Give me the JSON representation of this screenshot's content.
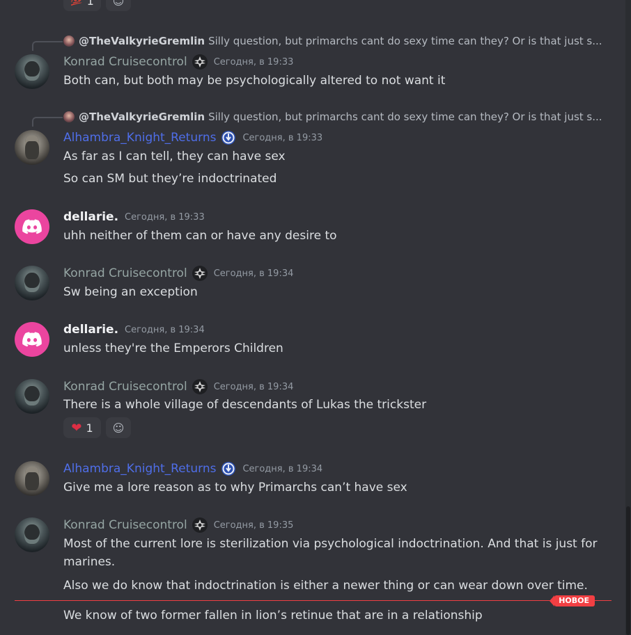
{
  "top_reactions": [
    {
      "emoji": "💯",
      "count": "1"
    },
    {
      "emoji": "☺"
    }
  ],
  "messages": [
    {
      "reply": {
        "name": "@TheValkyrieGremlin",
        "text": "Silly question, but primarchs cant do sexy time can they? Or is that just s..."
      },
      "author": "Konrad Cruisecontrol",
      "timestamp": "Сегодня, в 19:33",
      "lines": [
        "Both can, but both may be psychologically altered to not want it"
      ]
    },
    {
      "reply": {
        "name": "@TheValkyrieGremlin",
        "text": "Silly question, but primarchs cant do sexy time can they? Or is that just s..."
      },
      "author": "Alhambra_Knight_Returns",
      "timestamp": "Сегодня, в 19:33",
      "lines": [
        "As far as I can tell, they can have sex",
        "So can SM but they’re indoctrinated"
      ]
    },
    {
      "author": "dellarie.",
      "timestamp": "Сегодня, в 19:33",
      "lines": [
        "uhh neither of them can or have any desire to"
      ]
    },
    {
      "author": "Konrad Cruisecontrol",
      "timestamp": "Сегодня, в 19:34",
      "lines": [
        "Sw being an exception"
      ]
    },
    {
      "author": "dellarie.",
      "timestamp": "Сегодня, в 19:34",
      "lines": [
        "unless they're the Emperors Children"
      ]
    },
    {
      "author": "Konrad Cruisecontrol",
      "timestamp": "Сегодня, в 19:34",
      "lines": [
        "There is a whole village of descendants of Lukas the trickster"
      ],
      "reactions": [
        {
          "emoji": "❤",
          "count": "1"
        },
        {
          "emoji": "☺"
        }
      ]
    },
    {
      "author": "Alhambra_Knight_Returns",
      "timestamp": "Сегодня, в 19:34",
      "lines": [
        "Give me a lore reason as to why Primarchs can’t have sex"
      ]
    },
    {
      "author": "Konrad Cruisecontrol",
      "timestamp": "Сегодня, в 19:35",
      "lines": [
        "Most of the current lore is sterilization via psychological indoctrination. And that is just for marines.",
        "Also we do know that indoctrination is either a newer thing or can wear down over time.",
        "We know of two former fallen in lion’s retinue that are in a relationship"
      ]
    }
  ],
  "new_divider_label": "НОВОЕ",
  "colors": {
    "background": "#323339",
    "konrad_name": "#95a5a3",
    "alhambra_name": "#4f6ee8",
    "new_divider": "#f23f43",
    "discord_avatar": "#eb459f"
  },
  "icons": [
    "discord-logo-icon",
    "iron-cross-badge-icon",
    "ultramarines-badge-icon",
    "add-reaction-icon"
  ]
}
